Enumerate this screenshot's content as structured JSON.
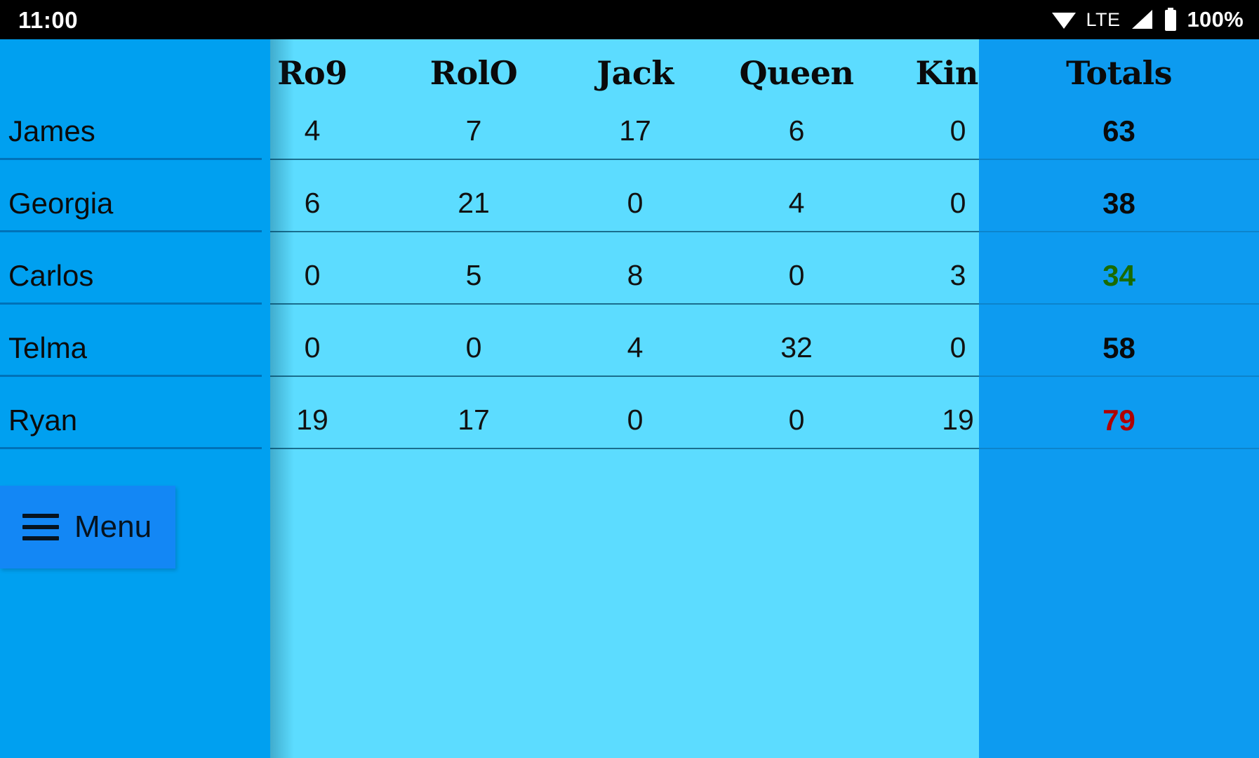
{
  "status_bar": {
    "clock": "11:00",
    "network_label": "LTE",
    "battery_percent": "100%",
    "icons": [
      "wifi-icon",
      "signal-icon",
      "battery-icon"
    ]
  },
  "table": {
    "name_column_header": "",
    "scrolled_columns": [
      "Ro9",
      "RolO",
      "Jack",
      "Queen",
      "King"
    ],
    "totals_header": "Totals",
    "rows": [
      {
        "name": "James",
        "values": [
          "4",
          "7",
          "17",
          "6",
          "0"
        ],
        "total": "63",
        "total_color": "#0A0A0A"
      },
      {
        "name": "Georgia",
        "values": [
          "6",
          "21",
          "0",
          "4",
          "0"
        ],
        "total": "38",
        "total_color": "#0A0A0A"
      },
      {
        "name": "Carlos",
        "values": [
          "0",
          "5",
          "8",
          "0",
          "3"
        ],
        "total": "34",
        "total_color": "#196B00"
      },
      {
        "name": "Telma",
        "values": [
          "0",
          "0",
          "4",
          "32",
          "0"
        ],
        "total": "58",
        "total_color": "#0A0A0A"
      },
      {
        "name": "Ryan",
        "values": [
          "19",
          "17",
          "0",
          "0",
          "19"
        ],
        "total": "79",
        "total_color": "#B00000"
      }
    ]
  },
  "menu_button": {
    "label": "Menu",
    "icon": "hamburger-icon"
  },
  "colors": {
    "status_bar_bg": "#000000",
    "frozen_column_bg": "#00A0F0",
    "scroll_area_bg": "#5CDCFF",
    "totals_column_bg": "#0D9BF0",
    "menu_button_bg": "#1387F5",
    "row_divider": "#1A6E8E"
  }
}
